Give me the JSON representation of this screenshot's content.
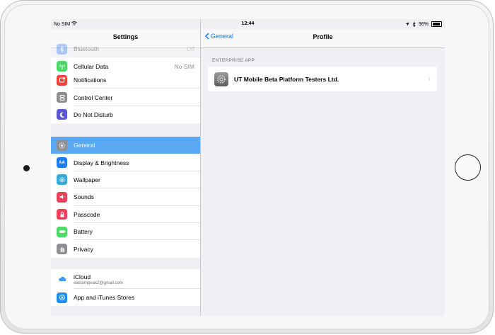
{
  "status_bar": {
    "carrier": "No SIM",
    "time": "12:44",
    "battery": "96%"
  },
  "master": {
    "title": "Settings",
    "group1": [
      {
        "label": "Bluetooth",
        "value": "Off",
        "icon": "bluetooth-icon",
        "color": "#2a7ff7"
      },
      {
        "label": "Cellular Data",
        "value": "No SIM",
        "icon": "cellular-icon",
        "color": "#4cd964"
      }
    ],
    "group2": [
      {
        "label": "Notifications",
        "icon": "notifications-icon",
        "color": "#f2413a"
      },
      {
        "label": "Control Center",
        "icon": "control-center-icon",
        "color": "#8e8e93"
      },
      {
        "label": "Do Not Disturb",
        "icon": "moon-icon",
        "color": "#5856d6"
      }
    ],
    "group3": [
      {
        "label": "General",
        "icon": "gear-icon",
        "color": "#8e8e93",
        "selected": true
      },
      {
        "label": "Display & Brightness",
        "icon": "display-icon",
        "color": "#1e7cf3"
      },
      {
        "label": "Wallpaper",
        "icon": "wallpaper-icon",
        "color": "#36aadc"
      },
      {
        "label": "Sounds",
        "icon": "sounds-icon",
        "color": "#f23e5a"
      },
      {
        "label": "Passcode",
        "icon": "lock-icon",
        "color": "#f23e5a"
      },
      {
        "label": "Battery",
        "icon": "battery-icon",
        "color": "#4cd964"
      },
      {
        "label": "Privacy",
        "icon": "hand-icon",
        "color": "#8e8e93"
      }
    ],
    "group4": [
      {
        "label": "iCloud",
        "sublabel": "easternpeak2@gmail.com",
        "icon": "icloud-icon",
        "color": "#ffffff"
      },
      {
        "label": "App and iTunes Stores",
        "icon": "app-store-icon",
        "color": "#1f8ef2"
      }
    ]
  },
  "detail": {
    "back_label": "General",
    "title": "Profile",
    "section_header": "ENTERPRISE APP",
    "profile_name": "UT Mobile Beta Platform Testers Ltd."
  }
}
